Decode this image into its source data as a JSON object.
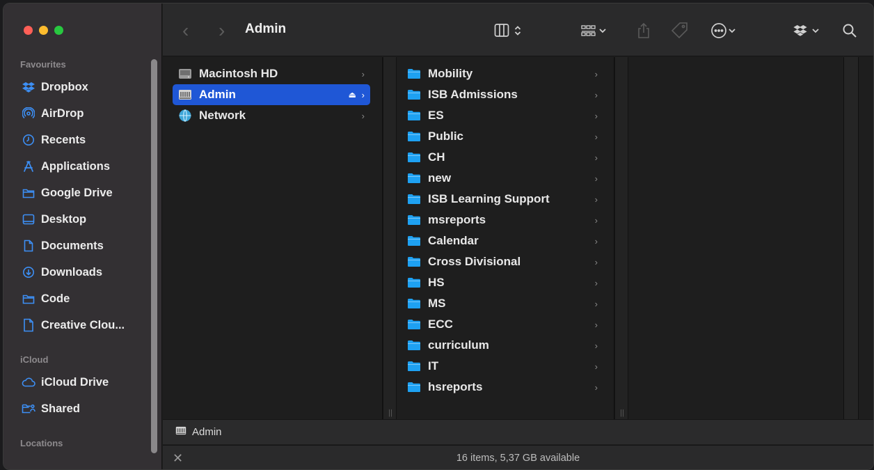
{
  "window": {
    "title": "Admin"
  },
  "sidebar": {
    "sections": {
      "favourites": "Favourites",
      "icloud": "iCloud",
      "locations": "Locations"
    },
    "favourites": [
      {
        "label": "Dropbox",
        "icon": "dropbox-icon"
      },
      {
        "label": "AirDrop",
        "icon": "airdrop-icon"
      },
      {
        "label": "Recents",
        "icon": "clock-icon"
      },
      {
        "label": "Applications",
        "icon": "applications-icon"
      },
      {
        "label": "Google Drive",
        "icon": "folder-icon"
      },
      {
        "label": "Desktop",
        "icon": "desktop-icon"
      },
      {
        "label": "Documents",
        "icon": "document-icon"
      },
      {
        "label": "Downloads",
        "icon": "download-icon"
      },
      {
        "label": "Code",
        "icon": "folder-icon"
      },
      {
        "label": "Creative Clou...",
        "icon": "document-icon"
      }
    ],
    "icloud": [
      {
        "label": "iCloud Drive",
        "icon": "cloud-icon"
      },
      {
        "label": "Shared",
        "icon": "shared-folder-icon"
      }
    ]
  },
  "toolbar": {
    "back": "‹",
    "forward": "›",
    "view": "column-view-icon",
    "group": "grid-group-icon",
    "share": "share-icon",
    "tag": "tag-icon",
    "more": "ellipsis-circle-icon",
    "dropbox": "dropbox-icon",
    "search": "search-icon"
  },
  "column1": [
    {
      "label": "Macintosh HD",
      "icon": "hard-drive-icon",
      "selected": false
    },
    {
      "label": "Admin",
      "icon": "server-icon",
      "selected": true
    },
    {
      "label": "Network",
      "icon": "network-globe-icon",
      "selected": false
    }
  ],
  "column2": [
    {
      "label": "Mobility"
    },
    {
      "label": "ISB Admissions"
    },
    {
      "label": "ES"
    },
    {
      "label": "Public"
    },
    {
      "label": "CH"
    },
    {
      "label": "new"
    },
    {
      "label": "ISB Learning Support"
    },
    {
      "label": "msreports"
    },
    {
      "label": "Calendar"
    },
    {
      "label": "Cross Divisional"
    },
    {
      "label": "HS"
    },
    {
      "label": "MS"
    },
    {
      "label": "ECC"
    },
    {
      "label": "curriculum"
    },
    {
      "label": "IT"
    },
    {
      "label": "hsreports"
    }
  ],
  "pathbar": {
    "label": "Admin"
  },
  "statusbar": {
    "text": "16 items, 5,37 GB available",
    "close": "✕"
  },
  "colors": {
    "selection": "#1f57d6",
    "folder": "#1ea1f2",
    "sidebar_icon": "#3d8ff5"
  }
}
